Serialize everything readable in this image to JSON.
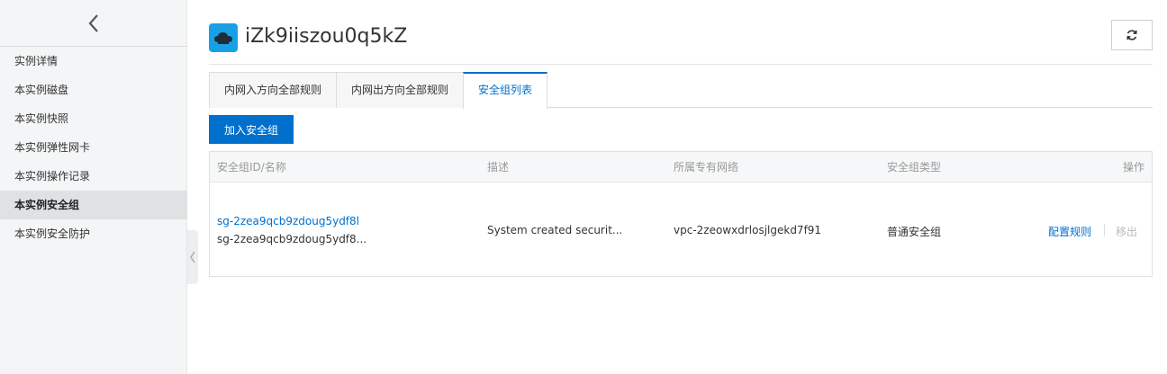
{
  "sidebar": {
    "items": [
      {
        "label": "实例详情"
      },
      {
        "label": "本实例磁盘"
      },
      {
        "label": "本实例快照"
      },
      {
        "label": "本实例弹性网卡"
      },
      {
        "label": "本实例操作记录"
      },
      {
        "label": "本实例安全组"
      },
      {
        "label": "本实例安全防护"
      }
    ]
  },
  "header": {
    "title": "iZk9iiszou0q5kZ"
  },
  "tabs": [
    {
      "label": "内网入方向全部规则"
    },
    {
      "label": "内网出方向全部规则"
    },
    {
      "label": "安全组列表"
    }
  ],
  "add_button": "加入安全组",
  "table": {
    "columns": [
      "安全组ID/名称",
      "描述",
      "所属专有网络",
      "安全组类型",
      "操作"
    ],
    "rows": [
      {
        "id": "sg-2zea9qcb9zdoug5ydf8l",
        "name": "sg-2zea9qcb9zdoug5ydf8...",
        "description": "System created securit...",
        "vpc": "vpc-2zeowxdrlosjlgekd7f91",
        "type": "普通安全组",
        "action_config": "配置规则",
        "action_remove": "移出"
      }
    ]
  },
  "colors": {
    "accent": "#0070cc",
    "brand_orange": "#ff6a00",
    "icon_bg": "#17a0e6"
  }
}
